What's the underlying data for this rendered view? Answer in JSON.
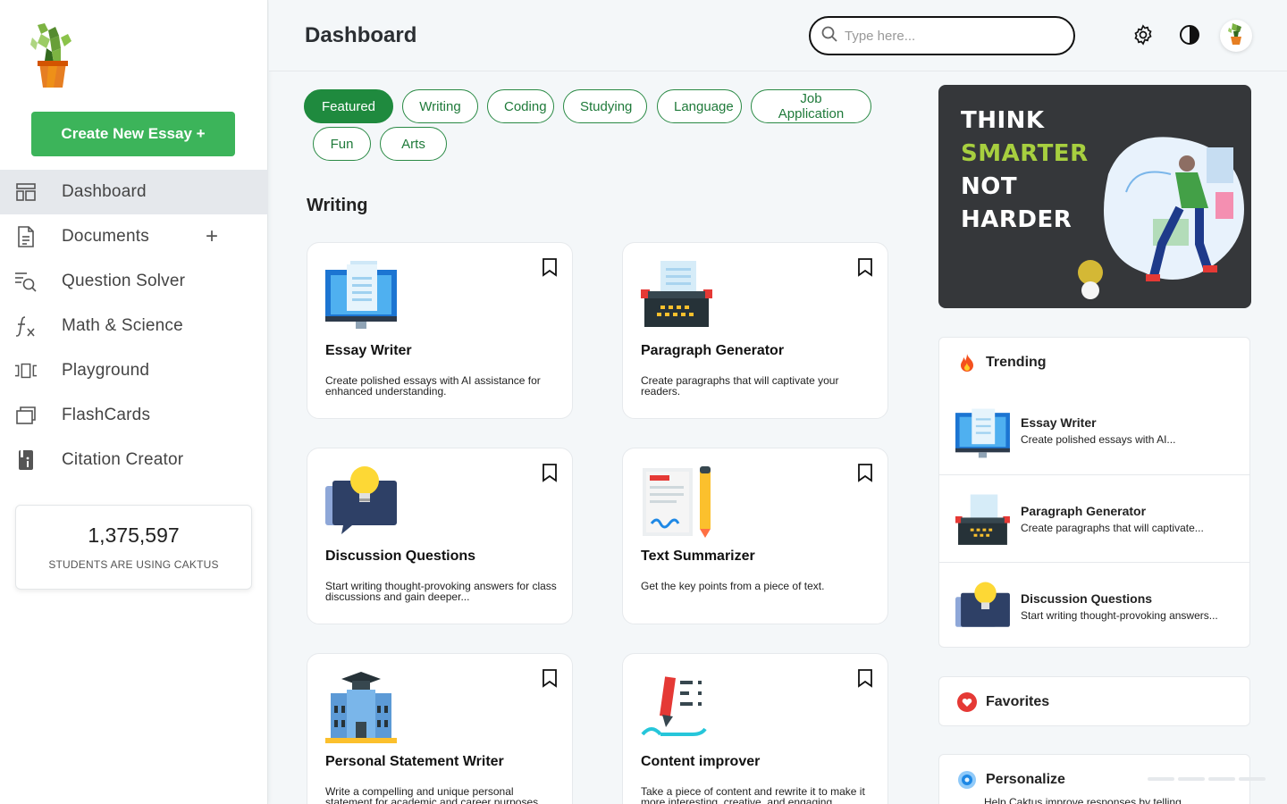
{
  "app": {
    "logo_icon": "cactus-logo-icon",
    "create_button": "Create New Essay +"
  },
  "nav": [
    {
      "label": "Dashboard",
      "icon": "dashboard-icon",
      "active": true
    },
    {
      "label": "Documents",
      "icon": "document-icon",
      "extra": "+"
    },
    {
      "label": "Question Solver",
      "icon": "search-list-icon"
    },
    {
      "label": "Math & Science",
      "icon": "function-icon"
    },
    {
      "label": "Playground",
      "icon": "carousel-icon"
    },
    {
      "label": "FlashCards",
      "icon": "cards-icon"
    },
    {
      "label": "Citation Creator",
      "icon": "citation-book-icon"
    }
  ],
  "stats": {
    "count": "1,375,597",
    "caption": "STUDENTS ARE USING CAKTUS"
  },
  "header": {
    "title": "Dashboard",
    "search_placeholder": "Type here...",
    "icons": [
      "gear-icon",
      "contrast-icon",
      "avatar-cactus-icon"
    ]
  },
  "filters": [
    "Featured",
    "Writing",
    "Coding",
    "Studying",
    "Language",
    "Job Application",
    "Fun",
    "Arts"
  ],
  "active_filter": "Featured",
  "section": {
    "title": "Writing"
  },
  "cards": [
    {
      "title": "Essay Writer",
      "desc": "Create polished essays with AI assistance for enhanced understanding.",
      "icon": "monitor-document-icon"
    },
    {
      "title": "Paragraph Generator",
      "desc": "Create paragraphs that will captivate your readers.",
      "icon": "typewriter-icon"
    },
    {
      "title": "Discussion Questions",
      "desc": "Start writing thought-provoking answers for class discussions and gain deeper...",
      "icon": "lightbulb-chat-icon"
    },
    {
      "title": "Text Summarizer",
      "desc": "Get the key points from a piece of text.",
      "icon": "document-pencil-icon"
    },
    {
      "title": "Personal Statement Writer",
      "desc": "Write a compelling and unique personal statement for academic and career purposes.",
      "icon": "graduation-building-icon"
    },
    {
      "title": "Content improver",
      "desc": "Take a piece of content and rewrite it to make it more interesting, creative, and engaging.",
      "icon": "pen-lines-icon"
    }
  ],
  "promo": {
    "line1": "THINK",
    "line2": "SMARTER",
    "line3": "NOT",
    "line4": "HARDER",
    "accent_color": "#a7cf3f"
  },
  "trending": {
    "title": "Trending",
    "icon": "fire-icon",
    "items": [
      {
        "title": "Essay Writer",
        "desc": "Create polished essays with AI..."
      },
      {
        "title": "Paragraph Generator",
        "desc": "Create paragraphs that will captivate..."
      },
      {
        "title": "Discussion Questions",
        "desc": "Start writing thought-provoking answers..."
      }
    ]
  },
  "favorites": {
    "title": "Favorites",
    "icon": "heart-icon"
  },
  "personalize": {
    "title": "Personalize",
    "icon": "target-icon",
    "desc": "Help Caktus improve responses by telling"
  },
  "colors": {
    "brand_green": "#3cb45a",
    "chip_green": "#1f8a3e",
    "promo_bg": "#35373a"
  }
}
